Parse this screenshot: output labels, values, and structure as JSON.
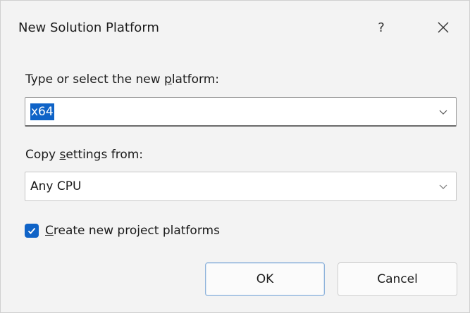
{
  "window": {
    "title": "New Solution Platform",
    "help_label": "?",
    "close_icon": "close-icon"
  },
  "platform": {
    "label_before": "Type or select the new ",
    "label_underlined": "p",
    "label_after": "latform:",
    "value": "x64"
  },
  "copy_settings": {
    "label_before": "Copy ",
    "label_underlined": "s",
    "label_after": "ettings from:",
    "value": "Any CPU"
  },
  "create_platforms": {
    "checked": true,
    "label_underlined": "C",
    "label_after": "reate new project platforms"
  },
  "buttons": {
    "ok": "OK",
    "cancel": "Cancel"
  },
  "colors": {
    "accent": "#0f63c7",
    "background": "#f3f3f3"
  }
}
